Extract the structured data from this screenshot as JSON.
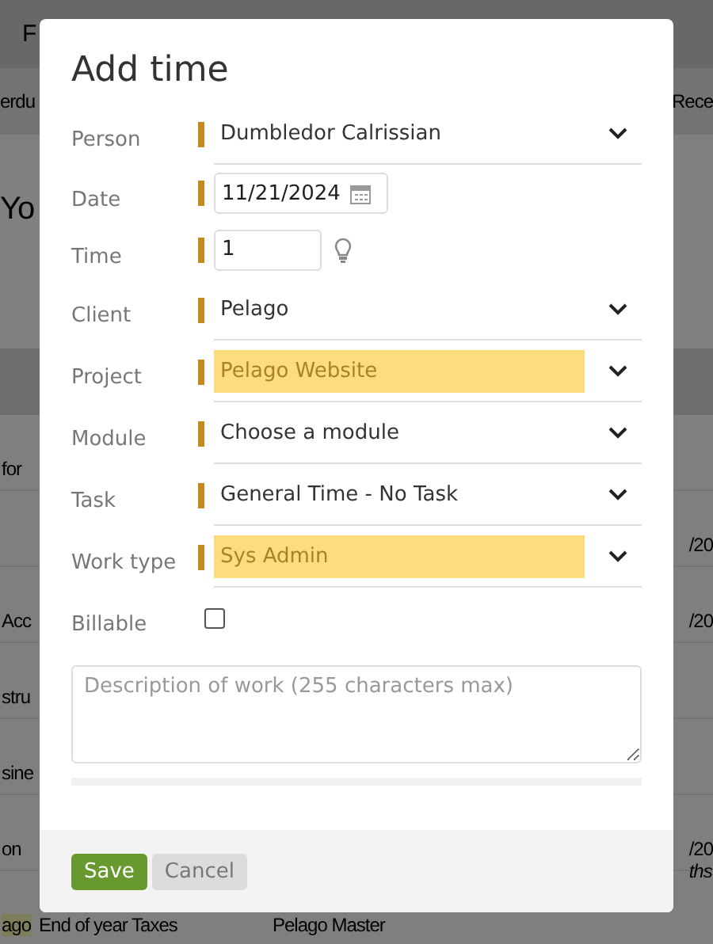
{
  "background": {
    "top_bar": {
      "text": "F"
    },
    "sub_nav": {
      "left": "erdu",
      "right": "Rece"
    },
    "heading": "Yo",
    "rows": [
      {
        "left": "for",
        "right": ""
      },
      {
        "left": "",
        "right": "/20"
      },
      {
        "left": "Acc",
        "right": "/20"
      },
      {
        "left": "stru",
        "right": ""
      },
      {
        "left": "sine",
        "right": ""
      },
      {
        "left": "on",
        "right": "/20",
        "right_sub": "ths"
      },
      {
        "left_tag": "ago",
        "left": "End of year Taxes",
        "middle": "Pelago Master",
        "right": ""
      }
    ]
  },
  "dialog": {
    "title": "Add time",
    "fields": [
      {
        "kind": "select",
        "label": "Person",
        "required": true,
        "value": "Dumbledor Calrissian",
        "highlighted": false
      },
      {
        "kind": "date",
        "label": "Date",
        "required": true,
        "value": "11/21/2024"
      },
      {
        "kind": "number",
        "label": "Time",
        "required": true,
        "value": "1"
      },
      {
        "kind": "select",
        "label": "Client",
        "required": true,
        "value": "Pelago",
        "highlighted": false
      },
      {
        "kind": "select",
        "label": "Project",
        "required": true,
        "value": "Pelago Website",
        "highlighted": true
      },
      {
        "kind": "select",
        "label": "Module",
        "required": true,
        "value": "Choose a module",
        "highlighted": false
      },
      {
        "kind": "select",
        "label": "Task",
        "required": true,
        "value": "General Time - No Task",
        "highlighted": false
      },
      {
        "kind": "select",
        "label": "Work type",
        "required": true,
        "value": "Sys Admin",
        "highlighted": true
      },
      {
        "kind": "checkbox",
        "label": "Billable",
        "required": false,
        "checked": false
      }
    ],
    "description": {
      "placeholder": "Description of work (255 characters max)"
    },
    "buttons": [
      {
        "kind": "primary",
        "label": "Save"
      },
      {
        "kind": "secondary",
        "label": "Cancel"
      }
    ]
  }
}
